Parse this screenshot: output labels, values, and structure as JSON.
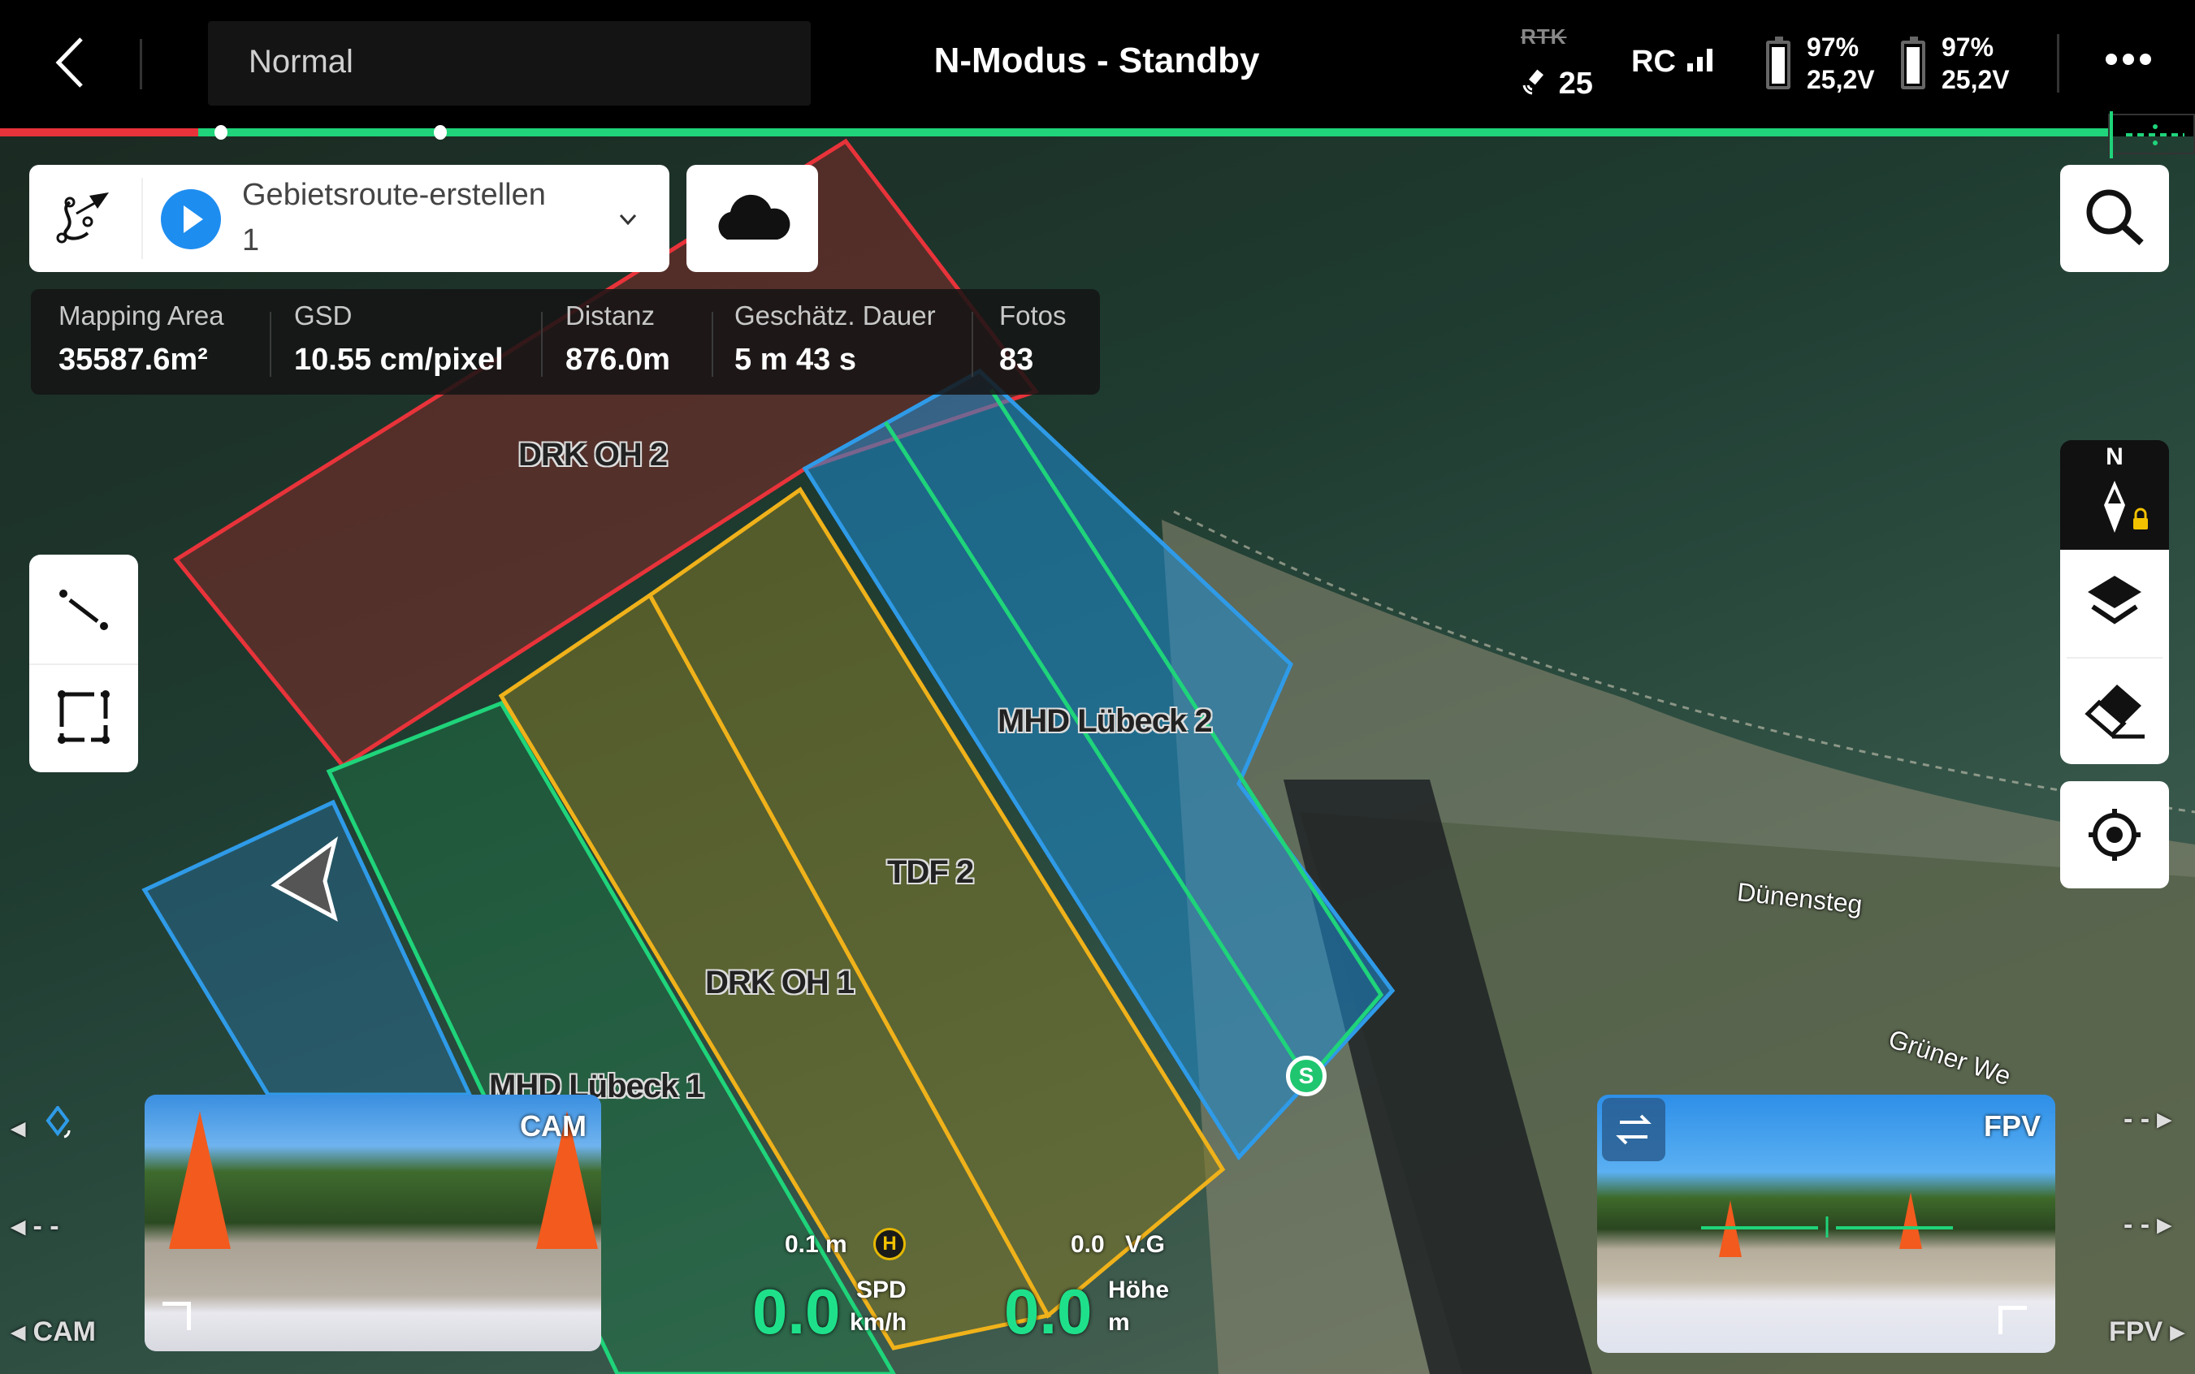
{
  "topbar": {
    "mode_dropdown": "Normal",
    "title": "N-Modus - Standby",
    "rtk_label": "RTK",
    "satellite_count": "25",
    "rc_label": "RC",
    "battery1": {
      "percent": "97%",
      "voltage": "25,2V"
    },
    "battery2": {
      "percent": "97%",
      "voltage": "25,2V"
    }
  },
  "progress": {
    "colors": {
      "done": "#e8333a",
      "remaining": "#1fd47a"
    }
  },
  "route": {
    "name": "Gebietsroute-erstellen",
    "number": "1"
  },
  "stats": [
    {
      "label": "Mapping Area",
      "value": "35587.6m²"
    },
    {
      "label": "GSD",
      "value": "10.55 cm/pixel"
    },
    {
      "label": "Distanz",
      "value": "876.0m"
    },
    {
      "label": "Geschätz. Dauer",
      "value": "5 m 43 s"
    },
    {
      "label": "Fotos",
      "value": "83"
    }
  ],
  "map": {
    "compass_label": "N",
    "areas": [
      {
        "label": "DRK OH 2",
        "color": "#e8333a"
      },
      {
        "label": "MHD Lübeck 2",
        "color": "#2f9be8"
      },
      {
        "label": "TDF 2",
        "color": "#f0b21a"
      },
      {
        "label": "DRK OH 1",
        "color": "#f0b21a"
      },
      {
        "label": "MHD Lübeck 1",
        "color": "#1fd47a"
      }
    ],
    "streets": [
      "Dünensteg",
      "Grüner We"
    ],
    "start_marker": "S"
  },
  "hud": {
    "height_above": "0.1 m",
    "home_badge": "H",
    "vs_value": "0.0",
    "vs_label": "V.G",
    "speed_value": "0.0",
    "speed_label": "SPD",
    "speed_unit": "km/h",
    "alt_value": "0.0",
    "alt_label": "Höhe",
    "alt_unit": "m"
  },
  "cam_view": {
    "label": "CAM",
    "side_label": "CAM",
    "side_dashes": "- -"
  },
  "fpv_view": {
    "label": "FPV",
    "side_label": "FPV",
    "side_dashes": "- -"
  }
}
